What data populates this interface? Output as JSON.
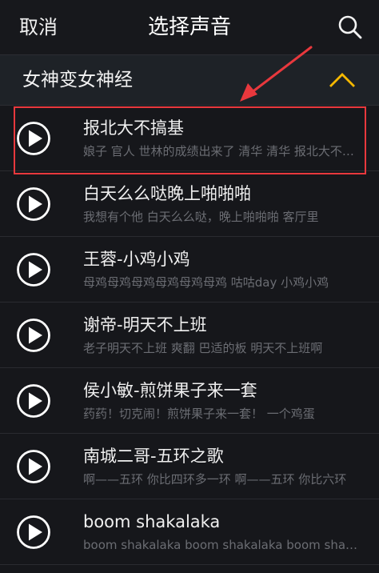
{
  "nav": {
    "cancel_label": "取消",
    "title": "选择声音",
    "search_icon": "search-icon"
  },
  "category": {
    "label": "女神变女神经",
    "state_icon": "chevron-up-icon",
    "accent_color": "#f5b800"
  },
  "sounds": [
    {
      "title": "报北大不搞基",
      "subtitle": "娘子 官人 世林的成绩出来了 清华 清华 报北大不搞基"
    },
    {
      "title": "白天么么哒晚上啪啪啪",
      "subtitle": "我想有个他 白天么么哒，晚上啪啪啪 客厅里"
    },
    {
      "title": "王蓉-小鸡小鸡",
      "subtitle": "母鸡母鸡母鸡母鸡母鸡母鸡 咕咕day 小鸡小鸡"
    },
    {
      "title": "谢帝-明天不上班",
      "subtitle": "老子明天不上班 爽翻 巴适的板 明天不上班啊"
    },
    {
      "title": "侯小敏-煎饼果子来一套",
      "subtitle": "药药！切克闹！煎饼果子来一套！ 一个鸡蛋"
    },
    {
      "title": "南城二哥-五环之歌",
      "subtitle": "啊——五环 你比四环多一环 啊——五环 你比六环"
    },
    {
      "title": "boom shakalaka",
      "subtitle": "boom shakalaka boom shakalaka boom shakalaka"
    }
  ],
  "highlight_color": "#e8383d"
}
